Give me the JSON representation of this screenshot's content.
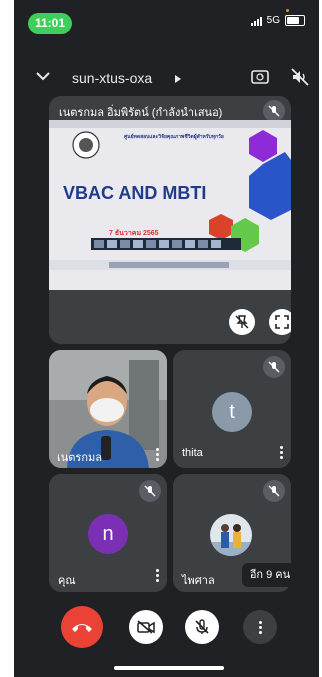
{
  "status_bar": {
    "time": "11:01",
    "network": "5G"
  },
  "top_bar": {
    "meeting_code": "sun-xtus-oxa"
  },
  "presentation": {
    "presenter_label": "เนตรกมล อิ่มพิรัตน์ (กำลังนำเสนอ)",
    "slide": {
      "title": "VBAC AND MBTI",
      "subtitle": "ศูนย์ทดสอบและวิจัยคุณภาพชีวิตผู้สำหรับทุกวัย",
      "date": "7 ธันวาคม 2565",
      "colors": {
        "background": "#e9e9ee",
        "title": "#203a8c",
        "hex_purple": "#8e2bd6",
        "hex_blue": "#2a55c9",
        "hex_red": "#d9432a",
        "hex_green": "#64c84a"
      }
    }
  },
  "participants": [
    {
      "name": "เนตรกมล",
      "type": "video"
    },
    {
      "name": "thita",
      "initial": "t",
      "avatar_color": "#8a9aa8",
      "muted": true
    },
    {
      "name": "คุณ",
      "initial": "n",
      "avatar_color": "#7b2fb5",
      "muted": true
    },
    {
      "name": "ไพศาล",
      "type": "photo",
      "muted": true,
      "others_label": "อีก 9 คน"
    }
  ],
  "controls": [
    "end-call",
    "camera-off",
    "mic-off",
    "more-options"
  ],
  "colors": {
    "background": "#202124",
    "tile": "#3c4043",
    "end_call": "#ea4335"
  }
}
